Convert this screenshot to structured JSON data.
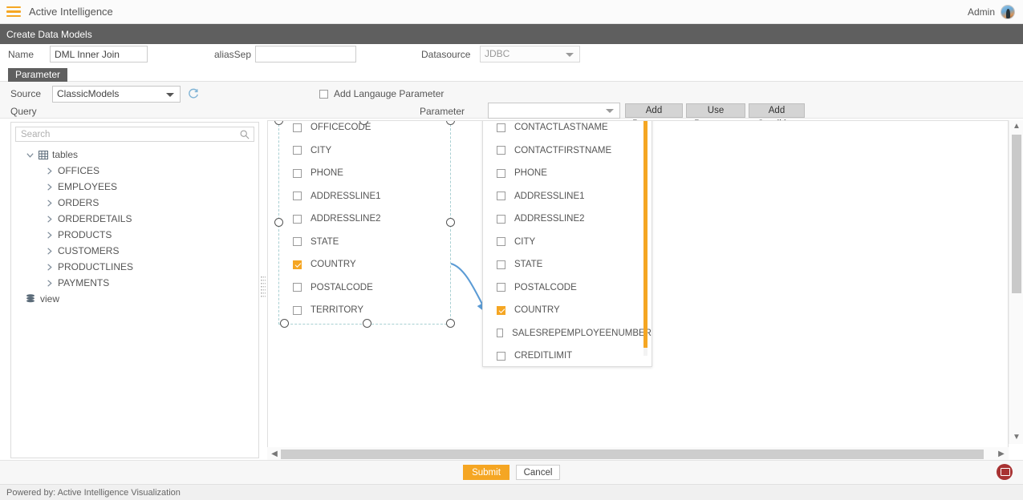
{
  "topbar": {
    "menu_icon": "hamburger-menu-icon",
    "app_title": "Active Intelligence",
    "user_label": "Admin",
    "avatar_icon": "user-avatar"
  },
  "page": {
    "title": "Create Data Models"
  },
  "form": {
    "name_label": "Name",
    "name_value": "DML Inner Join",
    "alias_label": "aliasSep",
    "alias_value": "",
    "alias_placeholder": "",
    "datasource_label": "Datasource",
    "datasource_value": "JDBC",
    "datasource_caret": "chevron-down-icon"
  },
  "tabs": {
    "parameter": "Parameter"
  },
  "source": {
    "source_label": "Source",
    "source_value": "ClassicModels",
    "refresh_icon": "refresh-icon",
    "query_label": "Query",
    "lang_checkbox_checked": false,
    "lang_label": "Add Langauge Parameter",
    "parameter_label": "Parameter",
    "parameter_value": "",
    "buttons": [
      {
        "label": "Add Parameter",
        "name": "add-parameter-button"
      },
      {
        "label": "Use Parameter",
        "name": "use-parameter-button"
      },
      {
        "label": "Add Condition",
        "name": "add-condition-button"
      }
    ]
  },
  "tree": {
    "search_placeholder": "Search",
    "search_value": "",
    "search_icon": "search-icon",
    "root_label": "tables",
    "root_icon": "table-grid-icon",
    "root_expanded": true,
    "tables": [
      "OFFICES",
      "EMPLOYEES",
      "ORDERS",
      "ORDERDETAILS",
      "PRODUCTS",
      "CUSTOMERS",
      "PRODUCTLINES",
      "PAYMENTS"
    ],
    "view_label": "view",
    "view_icon": "database-stack-icon"
  },
  "canvas": {
    "join_connector": "join-arrow-connector",
    "panel1": {
      "selected": true,
      "fields": [
        {
          "label": "OFFICECODE",
          "checked": false
        },
        {
          "label": "CITY",
          "checked": false
        },
        {
          "label": "PHONE",
          "checked": false
        },
        {
          "label": "ADDRESSLINE1",
          "checked": false
        },
        {
          "label": "ADDRESSLINE2",
          "checked": false
        },
        {
          "label": "STATE",
          "checked": false
        },
        {
          "label": "COUNTRY",
          "checked": true
        },
        {
          "label": "POSTALCODE",
          "checked": false
        },
        {
          "label": "TERRITORY",
          "checked": false
        }
      ]
    },
    "panel2": {
      "selected": false,
      "fields": [
        {
          "label": "CONTACTLASTNAME",
          "checked": false
        },
        {
          "label": "CONTACTFIRSTNAME",
          "checked": false
        },
        {
          "label": "PHONE",
          "checked": false
        },
        {
          "label": "ADDRESSLINE1",
          "checked": false
        },
        {
          "label": "ADDRESSLINE2",
          "checked": false
        },
        {
          "label": "CITY",
          "checked": false
        },
        {
          "label": "STATE",
          "checked": false
        },
        {
          "label": "POSTALCODE",
          "checked": false
        },
        {
          "label": "COUNTRY",
          "checked": true
        },
        {
          "label": "SALESREPEMPLOYEENUMBER",
          "checked": false
        },
        {
          "label": "CREDITLIMIT",
          "checked": false
        }
      ]
    }
  },
  "scrollbars": {
    "v_up_icon": "chevron-up-icon",
    "v_down_icon": "chevron-down-icon",
    "h_left_icon": "chevron-left-icon",
    "h_right_icon": "chevron-right-icon"
  },
  "footer": {
    "submit_label": "Submit",
    "cancel_label": "Cancel",
    "chat_icon": "chat-bubble-icon",
    "powered_by": "Powered by: Active Intelligence Visualization"
  },
  "colors": {
    "accent": "#f5a623",
    "titlebar": "#5f5f5f",
    "join_line": "#5b9bd5",
    "chat_fab": "#a83232"
  }
}
